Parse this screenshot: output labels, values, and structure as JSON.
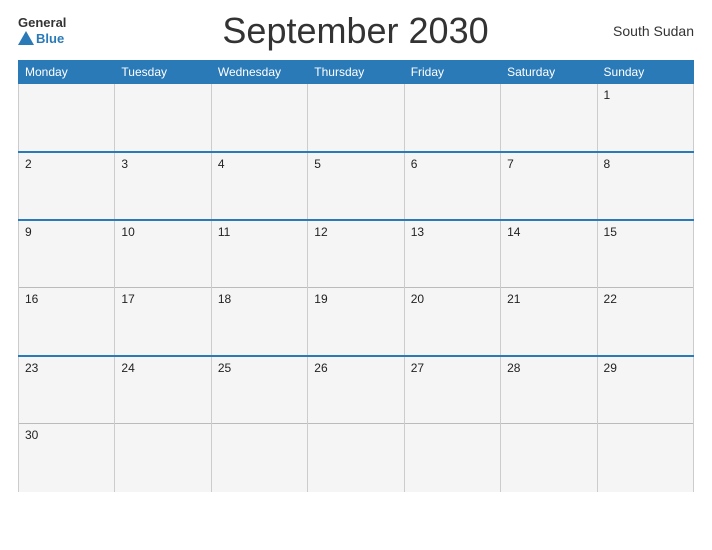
{
  "header": {
    "logo_general": "General",
    "logo_blue": "Blue",
    "title": "September 2030",
    "country": "South Sudan"
  },
  "weekdays": [
    "Monday",
    "Tuesday",
    "Wednesday",
    "Thursday",
    "Friday",
    "Saturday",
    "Sunday"
  ],
  "weeks": [
    [
      null,
      null,
      null,
      null,
      null,
      null,
      1
    ],
    [
      2,
      3,
      4,
      5,
      6,
      7,
      8
    ],
    [
      9,
      10,
      11,
      12,
      13,
      14,
      15
    ],
    [
      16,
      17,
      18,
      19,
      20,
      21,
      22
    ],
    [
      23,
      24,
      25,
      26,
      27,
      28,
      29
    ],
    [
      30,
      null,
      null,
      null,
      null,
      null,
      null
    ]
  ],
  "colors": {
    "header_bg": "#2a7ab8",
    "blue_accent": "#2a7ab8",
    "cell_bg": "#f5f5f5",
    "text": "#222",
    "border": "#bbb"
  }
}
